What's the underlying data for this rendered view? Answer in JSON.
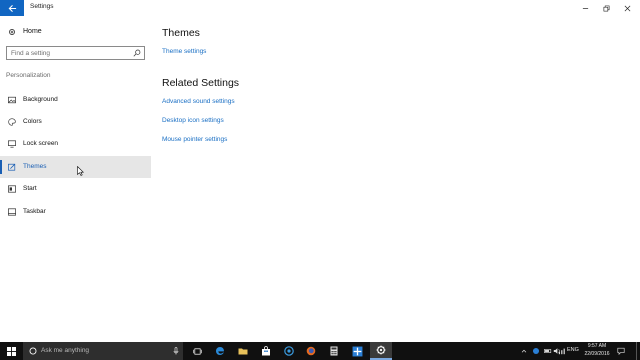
{
  "window": {
    "title": "Settings"
  },
  "sidebar": {
    "home": "Home",
    "search_placeholder": "Find a setting",
    "section": "Personalization",
    "items": [
      {
        "label": "Background",
        "icon": "image-icon"
      },
      {
        "label": "Colors",
        "icon": "palette-icon"
      },
      {
        "label": "Lock screen",
        "icon": "monitor-icon"
      },
      {
        "label": "Themes",
        "icon": "brush-icon",
        "active": true
      },
      {
        "label": "Start",
        "icon": "start-icon"
      },
      {
        "label": "Taskbar",
        "icon": "taskbar-icon"
      }
    ]
  },
  "main": {
    "title": "Themes",
    "theme_link": "Theme settings",
    "related_title": "Related Settings",
    "related_links": [
      "Advanced sound settings",
      "Desktop icon settings",
      "Mouse pointer settings"
    ]
  },
  "taskbar": {
    "search_placeholder": "Ask me anything",
    "language": "ENG",
    "time": "9:57 AM",
    "date": "22/09/2016"
  },
  "colors": {
    "accent": "#1a6fc4",
    "back_button": "#1166c2",
    "taskbar": "#101010"
  }
}
